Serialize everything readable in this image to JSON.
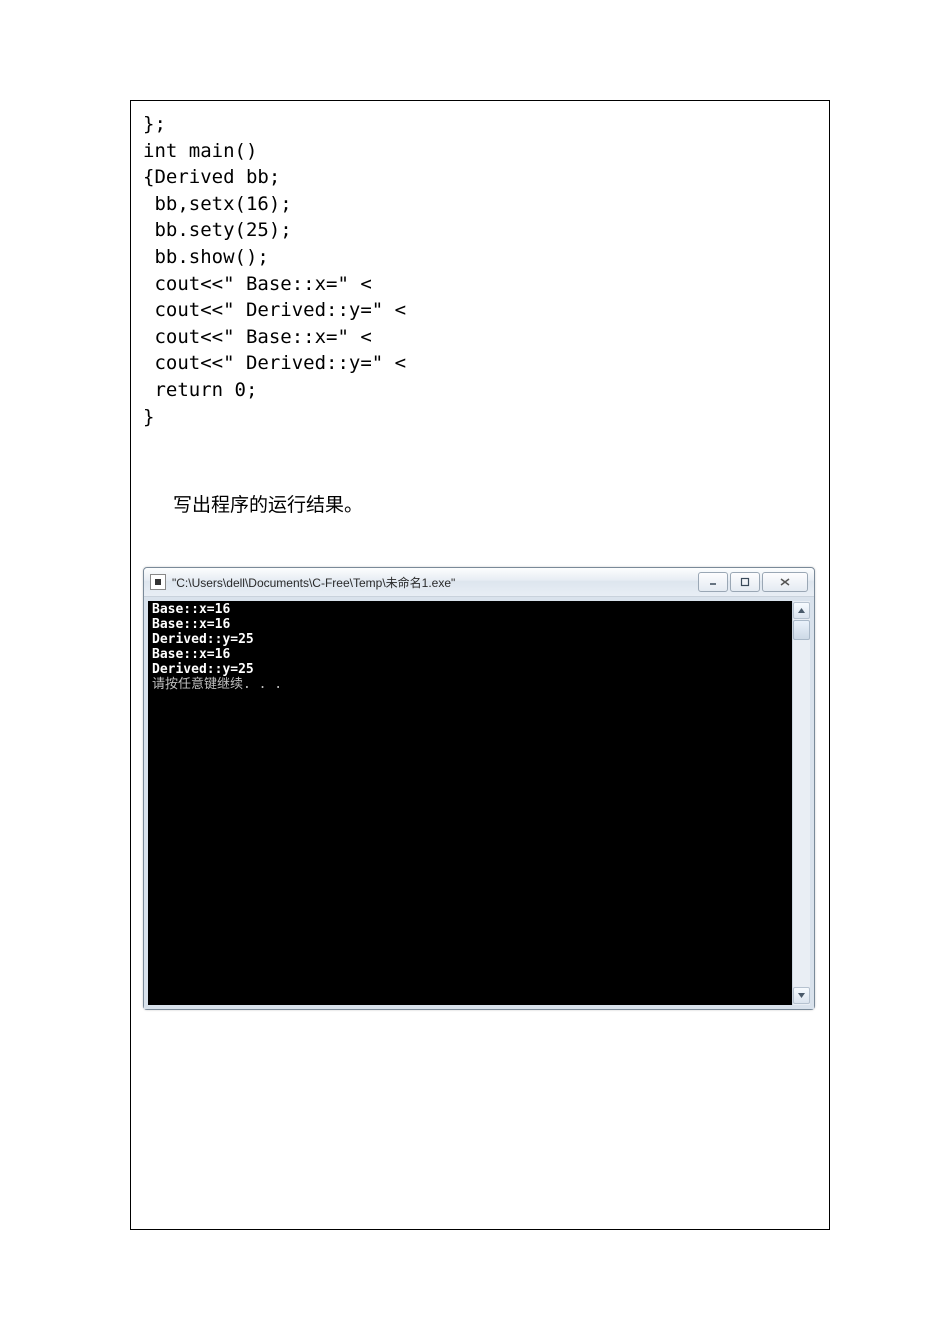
{
  "code": {
    "l1": "};",
    "l2": "int main()",
    "l3": "{Derived bb;",
    "l4": " bb,setx(16);",
    "l5": " bb.sety(25);",
    "l6": " bb.show();",
    "l7": " cout<<\" Base::x=\" <",
    "l8": " cout<<\" Derived::y=\" <",
    "l9": " cout<<\" Base::x=\" <",
    "l10": " cout<<\" Derived::y=\" <",
    "l11": " return 0;",
    "l12": "}"
  },
  "prompt": "写出程序的运行结果。",
  "console": {
    "title": "\"C:\\Users\\dell\\Documents\\C-Free\\Temp\\未命名1.exe\"",
    "out1": "Base::x=16",
    "out2": "Base::x=16",
    "out3": "Derived::y=25",
    "out4": "Base::x=16",
    "out5": "Derived::y=25",
    "out6": "请按任意键继续. . ."
  }
}
